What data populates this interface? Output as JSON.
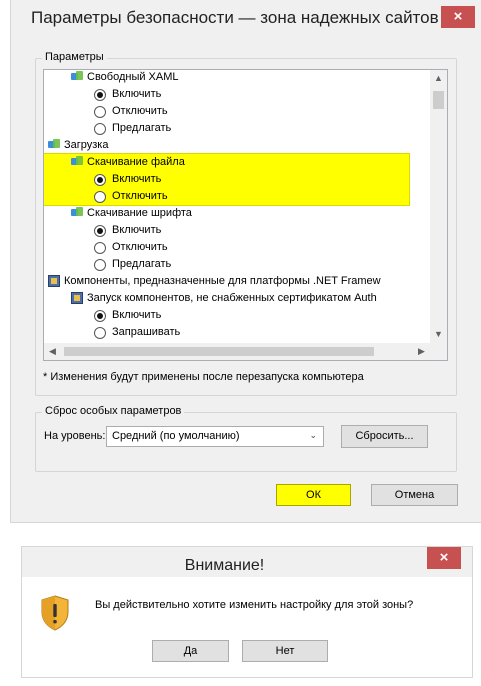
{
  "security_dialog": {
    "title": "Параметры безопасности — зона надежных сайтов",
    "close_label": "×",
    "params_group": "Параметры",
    "tree": [
      {
        "icon": "ie",
        "label": "Свободный XAML",
        "level": 1
      },
      {
        "radio": "on",
        "label": "Включить",
        "level": 2
      },
      {
        "radio": "off",
        "label": "Отключить",
        "level": 2
      },
      {
        "radio": "off",
        "label": "Предлагать",
        "level": 2
      },
      {
        "icon": "ie",
        "label": "Загрузка",
        "level": 0
      },
      {
        "icon": "ie",
        "label": "Скачивание файла",
        "level": 1
      },
      {
        "radio": "on",
        "label": "Включить",
        "level": 2
      },
      {
        "radio": "off",
        "label": "Отключить",
        "level": 2
      },
      {
        "icon": "ie",
        "label": "Скачивание шрифта",
        "level": 1
      },
      {
        "radio": "on",
        "label": "Включить",
        "level": 2
      },
      {
        "radio": "off",
        "label": "Отключить",
        "level": 2
      },
      {
        "radio": "off",
        "label": "Предлагать",
        "level": 2
      },
      {
        "icon": "net",
        "label": "Компоненты, предназначенные для платформы .NET Framew",
        "level": 0
      },
      {
        "icon": "net",
        "label": "Запуск компонентов, не снабженных сертификатом Auth",
        "level": 1
      },
      {
        "radio": "on",
        "label": "Включить",
        "level": 2
      },
      {
        "radio": "off",
        "label": "Запрашивать",
        "level": 2
      }
    ],
    "note": "* Изменения будут применены после перезапуска компьютера",
    "reset_group": "Сброс особых параметров",
    "level_label": "На уровень:",
    "level_value": "Средний (по умолчанию)",
    "reset_button": "Сбросить...",
    "ok_button": "ОК",
    "cancel_button": "Отмена"
  },
  "warning_dialog": {
    "title": "Внимание!",
    "close_label": "×",
    "message": "Вы действительно хотите изменить настройку для этой зоны?",
    "yes_button": "Да",
    "no_button": "Нет"
  },
  "colors": {
    "highlight": "#ffff00",
    "close": "#c75050"
  }
}
